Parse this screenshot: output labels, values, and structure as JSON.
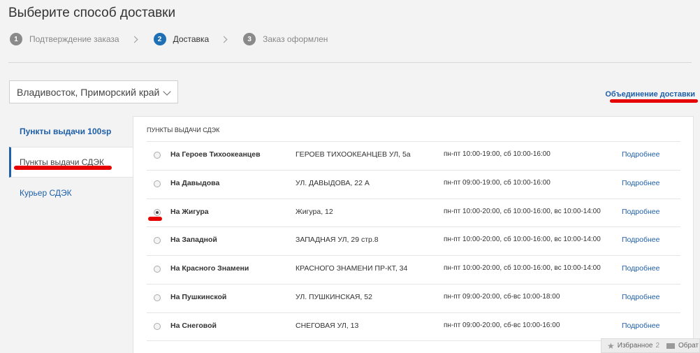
{
  "page_title": "Выберите способ доставки",
  "steps": [
    {
      "num": "1",
      "label": "Подтверждение заказа"
    },
    {
      "num": "2",
      "label": "Доставка"
    },
    {
      "num": "3",
      "label": "Заказ оформлен"
    }
  ],
  "city": "Владивосток, Приморский край",
  "merge_link": "Объединение доставки",
  "tabs": [
    {
      "label": "Пункты выдачи 100sp"
    },
    {
      "label": "Пункты выдачи СДЭК"
    },
    {
      "label": "Курьер СДЭК"
    }
  ],
  "panel_title": "ПУНКТЫ ВЫДАЧИ СДЭК",
  "points": [
    {
      "name": "На Героев Тихоокеанцев",
      "address": "ГЕРОЕВ ТИХООКЕАНЦЕВ УЛ, 5а",
      "hours": "пн-пт 10:00-19:00, сб 10:00-16:00",
      "more": "Подробнее",
      "selected": false
    },
    {
      "name": "На Давыдова",
      "address": "УЛ. ДАВЫДОВА, 22 А",
      "hours": "пн-пт 09:00-19:00, сб 10:00-16:00",
      "more": "Подробнее",
      "selected": false
    },
    {
      "name": "На Жигура",
      "address": "Жигура, 12",
      "hours": "пн-пт 10:00-20:00, сб 10:00-16:00, вс 10:00-14:00",
      "more": "Подробнее",
      "selected": true
    },
    {
      "name": "На Западной",
      "address": "ЗАПАДНАЯ УЛ, 29 стр.8",
      "hours": "пн-пт 10:00-20:00, сб 10:00-16:00, вс 10:00-14:00",
      "more": "Подробнее",
      "selected": false
    },
    {
      "name": "На Красного Знамени",
      "address": "КРАСНОГО ЗНАМЕНИ ПР-КТ, 34",
      "hours": "пн-пт 10:00-20:00, сб 10:00-16:00, вс 10:00-14:00",
      "more": "Подробнее",
      "selected": false
    },
    {
      "name": "На Пушкинской",
      "address": "УЛ. ПУШКИНСКАЯ, 52",
      "hours": "пн-пт 09:00-20:00, сб-вс 10:00-18:00",
      "more": "Подробнее",
      "selected": false
    },
    {
      "name": "На Снеговой",
      "address": "СНЕГОВАЯ УЛ, 13",
      "hours": "пн-пт 09:00-20:00, сб-вс 10:00-16:00",
      "more": "Подробнее",
      "selected": false
    }
  ],
  "footer": {
    "favorites_label": "Избранное",
    "favorites_count": "2",
    "feedback_label": "Обрат"
  }
}
